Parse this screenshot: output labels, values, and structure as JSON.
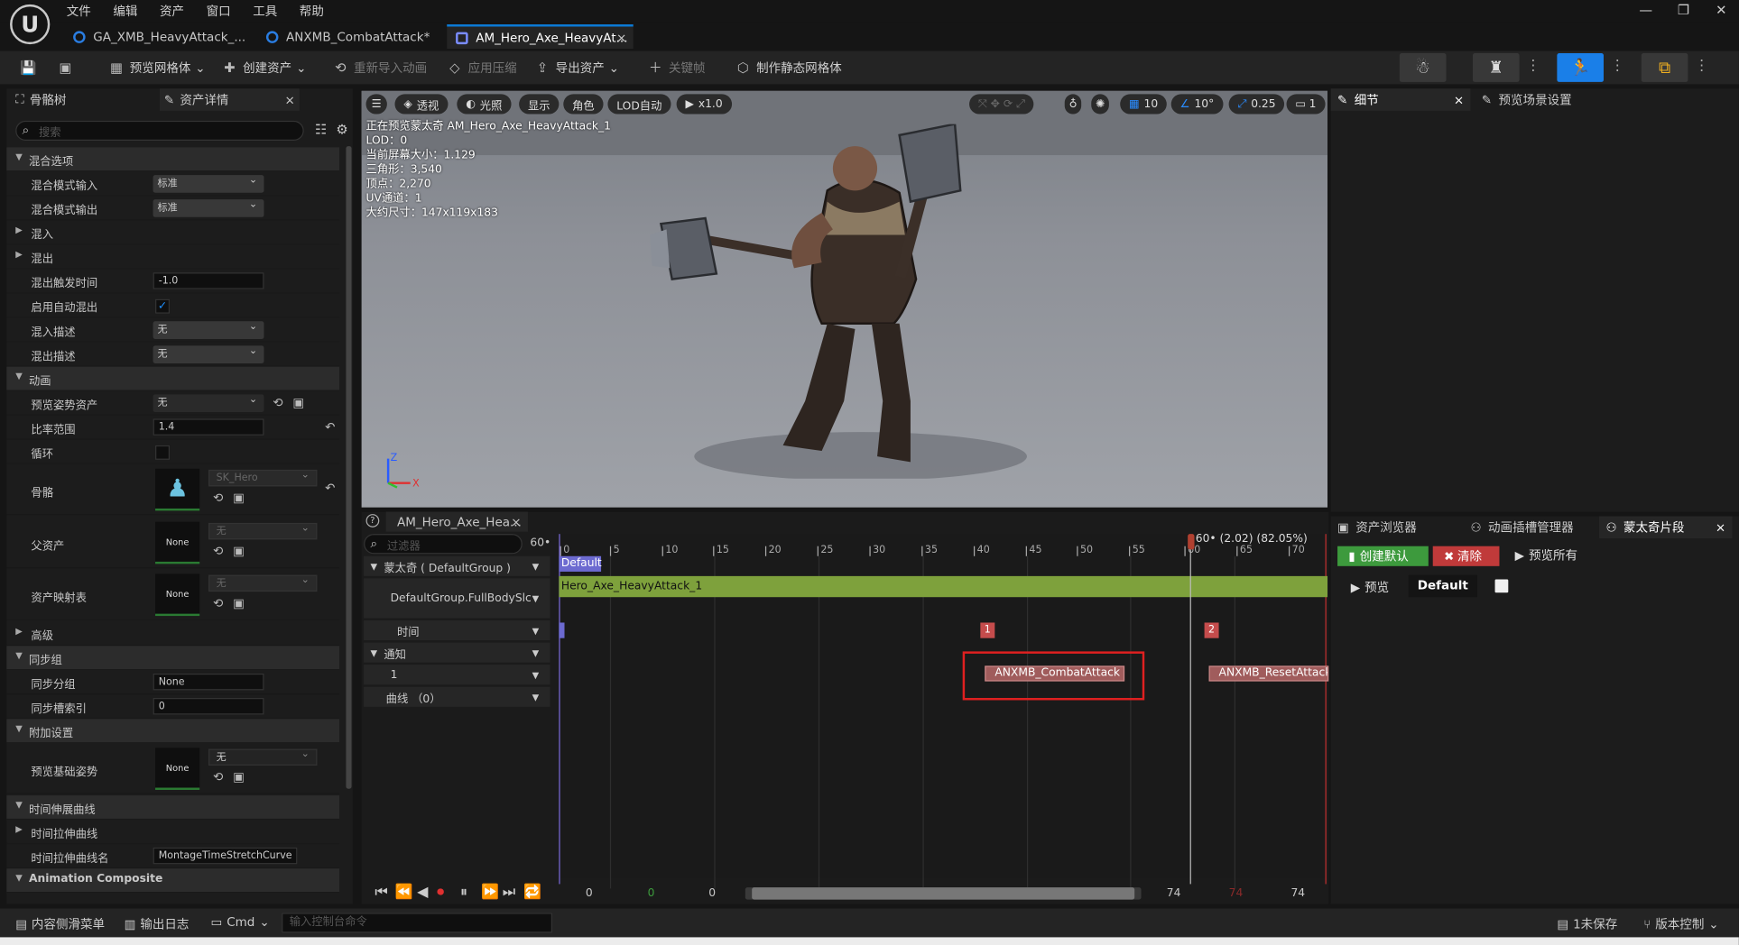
{
  "menu": [
    "文件",
    "编辑",
    "资产",
    "窗口",
    "工具",
    "帮助"
  ],
  "doc_tabs": [
    {
      "label": "GA_XMB_HeavyAttack_..."
    },
    {
      "label": "ANXMB_CombatAttack*"
    },
    {
      "label": "AM_Hero_Axe_HeavyAt..."
    }
  ],
  "toolbar": {
    "preview_mesh": "预览网格体",
    "create_asset": "创建资产",
    "reimport": "重新导入动画",
    "apply_compress": "应用压缩",
    "export_asset": "导出资产",
    "keyframe": "关键帧",
    "make_static_mesh": "制作静态网格体"
  },
  "left_tabs": {
    "skeleton_tree": "骨骼树",
    "asset_details": "资产详情"
  },
  "search_placeholder": "搜索",
  "props": {
    "blend_options": "混合选项",
    "blend_mode_in": "混合模式输入",
    "blend_mode_in_val": "标准",
    "blend_mode_out": "混合模式输出",
    "blend_mode_out_val": "标准",
    "blend_in": "混入",
    "blend_out": "混出",
    "blend_out_trigger": "混出触发时间",
    "blend_out_trigger_val": "-1.0",
    "enable_auto_blend_out": "启用自动混出",
    "blend_in_profile": "混入描述",
    "blend_in_profile_val": "无",
    "blend_out_profile": "混出描述",
    "blend_out_profile_val": "无",
    "animation": "动画",
    "preview_pose_asset": "预览姿势资产",
    "preview_pose_asset_val": "无",
    "rate_scale": "比率范围",
    "rate_scale_val": "1.4",
    "loop": "循环",
    "skeleton": "骨骼",
    "skeleton_val": "SK_Hero",
    "parent_asset": "父资产",
    "parent_asset_val": "无",
    "none": "None",
    "asset_mapping": "资产映射表",
    "asset_mapping_val": "无",
    "advanced": "高级",
    "sync_group": "同步组",
    "sync_group_name": "同步分组",
    "sync_group_name_val": "None",
    "sync_slot_index": "同步槽索引",
    "sync_slot_index_val": "0",
    "additive_settings": "附加设置",
    "preview_base_pose": "预览基础姿势",
    "preview_base_pose_val": "无",
    "time_stretch_curve_cat": "时间伸展曲线",
    "time_stretch_curve": "时间拉伸曲线",
    "time_stretch_curve_name": "时间拉伸曲线名",
    "time_stretch_curve_name_val": "MontageTimeStretchCurve",
    "animation_composite": "Animation Composite"
  },
  "viewport": {
    "perspective": "透视",
    "lit": "光照",
    "show": "显示",
    "character": "角色",
    "lod_auto": "LOD自动",
    "speed": "x1.0",
    "grid": "10",
    "angle": "10°",
    "scale": "0.25",
    "cam": "1",
    "info": [
      "正在预览蒙太奇 AM_Hero_Axe_HeavyAttack_1",
      "LOD：0",
      "当前屏幕大小：1.129",
      "三角形：3,540",
      "顶点：2,270",
      "UV通道：1",
      "大约尺寸：147x119x183"
    ]
  },
  "timeline": {
    "tab": "AM_Hero_Axe_Hea...",
    "filter_placeholder": "过滤器",
    "fps": "60•",
    "montage_label": "蒙太奇 ( DefaultGroup )",
    "slot_label": "DefaultGroup.FullBodySlc",
    "time_label": "时间",
    "notify_label": "通知",
    "notify_track": "1",
    "curve_label": "曲线 （0）",
    "section_default": "Default",
    "clip": "Hero_Axe_HeavyAttack_1",
    "ticks": [
      "0",
      "5",
      "10",
      "15",
      "20",
      "25",
      "30",
      "35",
      "40",
      "45",
      "50",
      "55",
      "60",
      "65",
      "70"
    ],
    "playhead": "60• (2.02) (82.05%)",
    "marker1": "1",
    "marker2": "2",
    "notify1": "ANXMB_CombatAttack",
    "notify2": "ANXMB_ResetAttack",
    "range_start": "0",
    "range_green": "0",
    "range_mid": "0",
    "range_end": "74",
    "range_red": "74",
    "range_end2": "74"
  },
  "right": {
    "details": "细节",
    "preview_scene": "预览场景设置",
    "asset_browser": "资产浏览器",
    "anim_slot_manager": "动画插槽管理器",
    "montage_sections": "蒙太奇片段",
    "create_default": "创建默认",
    "clear": "清除",
    "preview_all": "预览所有",
    "preview": "预览",
    "default_section": "Default"
  },
  "status": {
    "content_drawer": "内容侧滑菜单",
    "output_log": "输出日志",
    "cmd": "Cmd",
    "console_placeholder": "输入控制台命令",
    "unsaved": "1未保存",
    "source_control": "版本控制"
  },
  "colors": {
    "accent": "#1a7fe8",
    "clip_green": "#7ea13c",
    "notify_red": "#a05c5c",
    "highlight": "#e02020"
  }
}
